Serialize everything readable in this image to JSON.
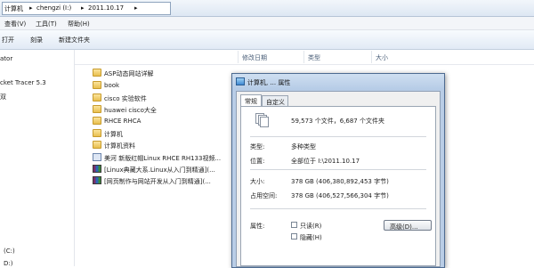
{
  "address": {
    "seg1": "计算机",
    "seg2": "chengzi (I:)",
    "seg3": "2011.10.17"
  },
  "menu": [
    "查看(V)",
    "工具(T)",
    "帮助(H)"
  ],
  "toolbar": {
    "open": "打开",
    "share": "刻录",
    "new_folder": "新建文件夹"
  },
  "nav": {
    "items": [
      "ator",
      "cket Tracer 5.3",
      "双"
    ],
    "bottom": [
      "(C:)",
      "D:)"
    ]
  },
  "columns": {
    "date": "修改日期",
    "type": "类型",
    "size": "大小"
  },
  "files": [
    {
      "name": "ASP动态网站详解",
      "kind": "folder"
    },
    {
      "name": "book",
      "kind": "folder"
    },
    {
      "name": "cisco  实验软件",
      "kind": "folder"
    },
    {
      "name": "huawei  cisco大全",
      "kind": "folder"
    },
    {
      "name": "RHCE RHCA",
      "kind": "folder"
    },
    {
      "name": "计算机",
      "kind": "folder"
    },
    {
      "name": "计算机资料",
      "kind": "folder"
    },
    {
      "name": "美河  新版红帽Linux RHCE RH133视频...",
      "kind": "media"
    },
    {
      "name": "[Linux典藏大系.Linux从入门到精通](...",
      "kind": "winrar"
    },
    {
      "name": "[网页制作与网站开发从入门到精通](...",
      "kind": "winrar"
    }
  ],
  "dialog": {
    "title": "计算机, ... 属性",
    "tabs": [
      "常规",
      "自定义"
    ],
    "summary": "59,573 个文件，6,687 个文件夹",
    "type_label": "类型:",
    "type_value": "多种类型",
    "location_label": "位置:",
    "location_value": "全部位于 I:\\2011.10.17",
    "size_label": "大小:",
    "size_value": "378 GB (406,380,892,453 字节)",
    "disk_label": "占用空间:",
    "disk_value": "378 GB (406,527,566,304 字节)",
    "attr_label": "属性:",
    "readonly_label": "只读(R)",
    "hidden_label": "隐藏(H)",
    "advanced_button": "高级(D)...",
    "colors": {
      "frame": "#b9cde6",
      "border": "#4e6b91"
    }
  }
}
